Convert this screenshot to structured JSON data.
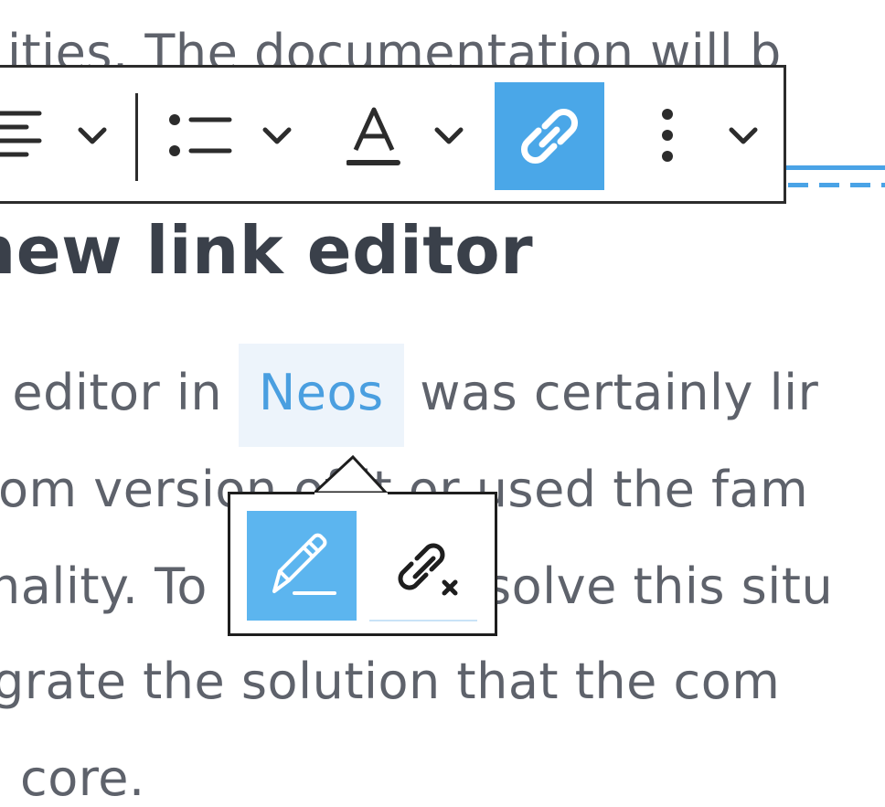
{
  "content": {
    "top_line": "ities. The documentation will b",
    "heading": "new link editor",
    "para": {
      "l1_before": "editor in",
      "l1_link": "Neos",
      "l1_after": "was certainly lir",
      "l2": "om version of it or used the fam",
      "l3_before": "nality. To",
      "l3_after": "solve this situ",
      "l4": "grate the solution that the com",
      "l5": "core."
    }
  },
  "toolbar": {
    "icons": [
      "align-icon",
      "chevron-down-icon",
      "list-icon",
      "chevron-down-icon",
      "text-format-icon",
      "chevron-down-icon",
      "link-icon",
      "more-vertical-icon",
      "chevron-down-icon"
    ],
    "active_item": "link-button"
  },
  "link_popup": {
    "icons": [
      "pencil-icon",
      "unlink-icon"
    ]
  },
  "colors": {
    "accent": "#4aa7e8",
    "link_text": "#4a9fe0",
    "link_highlight": "#edf4fb",
    "body_text": "#5e626b",
    "heading_text": "#3a404a",
    "border": "#2c2c2c"
  }
}
